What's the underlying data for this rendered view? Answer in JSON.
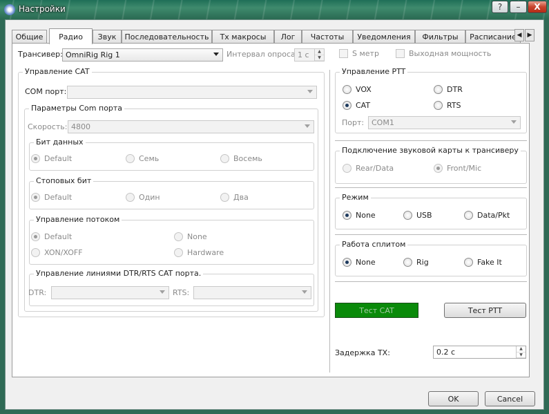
{
  "window": {
    "title": "Настройки",
    "close_glyph": "X",
    "minimize_glyph": "–",
    "help_glyph": "?"
  },
  "tabs": [
    {
      "label": "Общие"
    },
    {
      "label": "Радио"
    },
    {
      "label": "Звук"
    },
    {
      "label": "Последовательность"
    },
    {
      "label": "Tx макросы"
    },
    {
      "label": "Лог"
    },
    {
      "label": "Частоты"
    },
    {
      "label": "Уведомления"
    },
    {
      "label": "Фильтры"
    },
    {
      "label": "Расписание"
    }
  ],
  "active_tab": "Радио",
  "tab_scroll": {
    "left": "◀",
    "right": "▶"
  },
  "radio": {
    "transceiver_label": "Трансивер:",
    "transceiver_value": "OmniRig Rig 1",
    "poll_label": "Интервал опроса:",
    "poll_value": "1 с",
    "s_meter_label": "S метр",
    "output_power_label": "Выходная мощность",
    "cat": {
      "title": "Управление CAT",
      "com_port_label": "COM порт:",
      "com_port_value": "",
      "com_params_title": "Параметры Com порта",
      "speed_label": "Скорость:",
      "speed_value": "4800",
      "data_bits": {
        "title": "Бит данных",
        "options": [
          "Default",
          "Семь",
          "Восемь"
        ],
        "selected": "Default"
      },
      "stop_bits": {
        "title": "Стоповых бит",
        "options": [
          "Default",
          "Один",
          "Два"
        ],
        "selected": "Default"
      },
      "flow": {
        "title": "Управление потоком",
        "options": [
          "Default",
          "None",
          "XON/XOFF",
          "Hardware"
        ],
        "selected": "Default"
      },
      "lines": {
        "title": "Управление линиями DTR/RTS CAT порта.",
        "dtr_label": "DTR:",
        "rts_label": "RTS:",
        "dtr_value": "",
        "rts_value": ""
      }
    },
    "ptt": {
      "title": "Управление PTT",
      "options": [
        "VOX",
        "DTR",
        "CAT",
        "RTS"
      ],
      "selected": "CAT",
      "port_label": "Порт:",
      "port_value": "COM1"
    },
    "soundcard": {
      "title": "Подключение звуковой карты к трансиверу",
      "options": [
        "Rear/Data",
        "Front/Mic"
      ],
      "selected": "Front/Mic"
    },
    "mode": {
      "title": "Режим",
      "options": [
        "None",
        "USB",
        "Data/Pkt"
      ],
      "selected": "None"
    },
    "split": {
      "title": "Работа сплитом",
      "options": [
        "None",
        "Rig",
        "Fake It"
      ],
      "selected": "None"
    },
    "test_cat_label": "Тест CAT",
    "test_ptt_label": "Тест PTT",
    "tx_delay_label": "Задержка TX:",
    "tx_delay_value": "0.2 с"
  },
  "buttons": {
    "ok": "OK",
    "cancel": "Cancel"
  },
  "colors": {
    "test_cat_bg": "#0a8a0a",
    "titlebar": "#2f6a55"
  }
}
